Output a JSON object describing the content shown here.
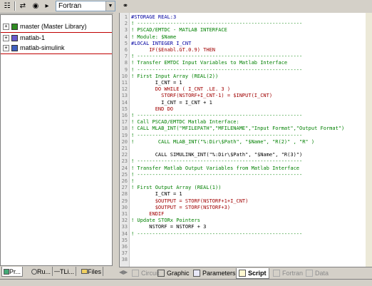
{
  "toolbar": {
    "language_select": "Fortran",
    "icons": [
      "format-icon",
      "find-icon",
      "navigate-icon",
      "link-icon"
    ]
  },
  "tree": {
    "items": [
      {
        "expander": "+",
        "label": "master (Master Library)",
        "icon_color": "#2e8b20"
      },
      {
        "expander": "+",
        "label": "matlab-1",
        "icon_color": "#6a5acd"
      },
      {
        "expander": "+",
        "label": "matlab-simulink",
        "icon_color": "#4060c0"
      }
    ]
  },
  "left_tabs": [
    {
      "label": "Pr...",
      "active": true
    },
    {
      "label": "Ru..."
    },
    {
      "label": "TLi..."
    },
    {
      "label": "Files"
    }
  ],
  "bottom_tabs": [
    {
      "label": "Circuit",
      "disabled": true
    },
    {
      "label": "Graphic"
    },
    {
      "label": "Parameters"
    },
    {
      "label": "Script",
      "active": true
    },
    {
      "label": "Fortran",
      "disabled": true
    },
    {
      "label": "Data",
      "disabled": true
    }
  ],
  "code_lines": [
    {
      "n": "1",
      "text": "#STORAGE REAL:3",
      "kind": "directive"
    },
    {
      "n": "2",
      "text": "! -------------------------------------------------------",
      "kind": "comment"
    },
    {
      "n": "3",
      "text": "! PSCAD/EMTDC - MATLAB INTERFACE",
      "kind": "comment"
    },
    {
      "n": "4",
      "text": "! Module: $Name",
      "kind": "comment"
    },
    {
      "n": "5",
      "text": "#LOCAL INTEGER I_CNT",
      "kind": "directive"
    },
    {
      "n": "6",
      "text": "      IF($Enabl.GT.0.9) THEN",
      "kind": "keyword"
    },
    {
      "n": "7",
      "text": "! -------------------------------------------------------",
      "kind": "comment"
    },
    {
      "n": "8",
      "text": "! Transfer EMTDC Input Variables to Matlab Interface",
      "kind": "comment"
    },
    {
      "n": "9",
      "text": "! -------------------------------------------------------",
      "kind": "comment"
    },
    {
      "n": "10",
      "text": "! First Input Array (REAL(2))",
      "kind": "comment"
    },
    {
      "n": "11",
      "text": "        I_CNT = 1",
      "kind": "code"
    },
    {
      "n": "12",
      "text": "        DO WHILE ( I_CNT .LE. 3 )",
      "kind": "keyword"
    },
    {
      "n": "13",
      "text": "          STORF(NSTORF+I_CNT-1) = $INPUT(I_CNT)",
      "kind": "keyword"
    },
    {
      "n": "14",
      "text": "          I_CNT = I_CNT + 1",
      "kind": "code"
    },
    {
      "n": "15",
      "text": "        END DO",
      "kind": "keyword"
    },
    {
      "n": "16",
      "text": "! -------------------------------------------------------",
      "kind": "comment"
    },
    {
      "n": "17",
      "text": "! Call PSCAD/EMTDC Matlab Interface:",
      "kind": "comment"
    },
    {
      "n": "18",
      "text": "! CALL MLAB_INT(\"MFILEPATH\",\"MFILENAME\",\"Input Format\",\"Output Format\")",
      "kind": "comment"
    },
    {
      "n": "19",
      "text": "! -------------------------------------------------------",
      "kind": "comment"
    },
    {
      "n": "20",
      "text": "!        CALL MLAB_INT(\"%:Dir\\$Path\", \"$Name\", \"R(2)\" , \"R\" )",
      "kind": "comment"
    },
    {
      "n": "21",
      "text": "",
      "kind": "code"
    },
    {
      "n": "22",
      "text": "        CALL SIMULINK_INT(\"%:Dir\\$Path\", \"$Name\", \"R(3)\")",
      "kind": "code"
    },
    {
      "n": "23",
      "text": "! -------------------------------------------------------",
      "kind": "comment"
    },
    {
      "n": "24",
      "text": "! Transfer Matlab Output Variables from Matlab Interface",
      "kind": "comment"
    },
    {
      "n": "25",
      "text": "! -------------------------------------------------------",
      "kind": "comment"
    },
    {
      "n": "26",
      "text": "!",
      "kind": "comment"
    },
    {
      "n": "27",
      "text": "! First Output Array (REAL(1))",
      "kind": "comment"
    },
    {
      "n": "28",
      "text": "        I_CNT = 1",
      "kind": "code"
    },
    {
      "n": "29",
      "text": "        $OUTPUT = STORF(NSTORF+1+I_CNT)",
      "kind": "keyword"
    },
    {
      "n": "30",
      "text": "        $OUTPUT = STORF(NSTORF+3)",
      "kind": "keyword"
    },
    {
      "n": "31",
      "text": "      ENDIF",
      "kind": "keyword"
    },
    {
      "n": "32",
      "text": "! Update STORx Pointers",
      "kind": "comment"
    },
    {
      "n": "33",
      "text": "      NSTORF = NSTORF + 3",
      "kind": "code"
    },
    {
      "n": "34",
      "text": "! -------------------------------------------------------",
      "kind": "comment"
    },
    {
      "n": "35",
      "text": "",
      "kind": "code"
    },
    {
      "n": "36",
      "text": "",
      "kind": "code"
    },
    {
      "n": "37",
      "text": "",
      "kind": "code"
    },
    {
      "n": "38",
      "text": "",
      "kind": "code"
    }
  ]
}
